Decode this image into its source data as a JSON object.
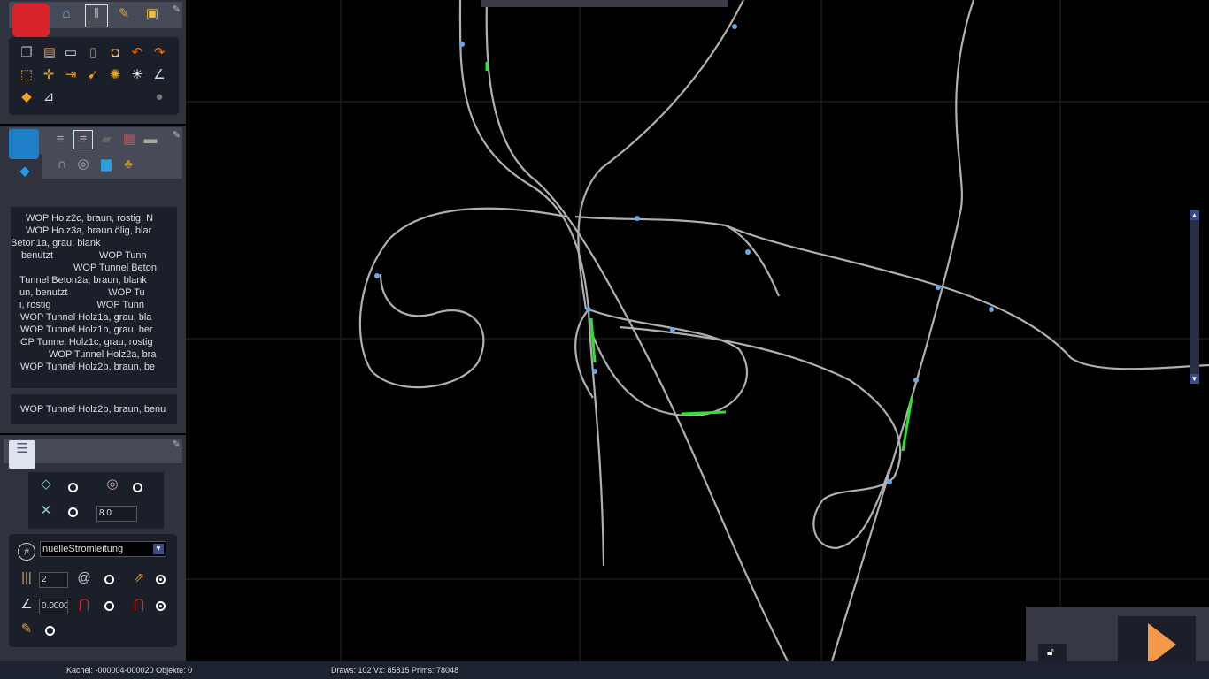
{
  "toolbar_top": {
    "icons": [
      "toolbox-icon",
      "home-icon",
      "track-editor-icon",
      "paint-brush-icon",
      "train-icon"
    ]
  },
  "edit_tools": {
    "icons": [
      "copy-icon",
      "paste-icon",
      "monitor-icon",
      "trash-icon",
      "measure-icon",
      "undo-icon",
      "redo-icon",
      "select-rect-icon",
      "split-icon",
      "join-icon",
      "move-icon",
      "center-icon",
      "crosshair-icon",
      "angle-icon",
      "shapes-icon",
      "ruler-icon",
      "light-icon"
    ]
  },
  "track_types": {
    "icons": [
      "cube-icon",
      "track-rail-icon",
      "track-rail-selected-icon",
      "road-icon",
      "wall-icon",
      "stone-icon",
      "tunnel-icon",
      "bridge-icon",
      "water-icon",
      "bag-icon"
    ]
  },
  "favorites": [
    {
      "color": "#a01010"
    },
    {
      "color": "#3a8a10"
    },
    {
      "color": "#1020a0"
    }
  ],
  "list": {
    "items": [
      "WOP Holz2c, braun, rostig, N",
      "WOP Holz3a, braun ölig, blar",
      "Beton1a, grau, blank",
      "benutzt                 WOP Tunn",
      "WOP Tunnel Beton",
      "Tunnel Beton2a, braun, blank",
      "un, benutzt               WOP Tu",
      "i, rostig                 WOP Tunn",
      "WOP Tunnel Holz1a, grau, bla",
      "WOP Tunnel Holz1b, grau, ber",
      "OP Tunnel Holz1c, grau, rostig",
      "WOP Tunnel Holz2a, bra",
      "WOP Tunnel Holz2b, braun, be"
    ],
    "selected": "WOP Tunnel Holz2b, braun, benu"
  },
  "properties": {
    "height_value": "8.0",
    "catenary_select": "nuelleStromleitung",
    "tracks_count": "2",
    "angle_value": "0.00000"
  },
  "status": {
    "tile": "Kachel: -000004-000020  Objekte: 0",
    "stats": "Draws: 102 Vx: 85815 Prims: 78048"
  },
  "colors": {
    "panel": "#30333e",
    "play": "#f39a4a"
  }
}
